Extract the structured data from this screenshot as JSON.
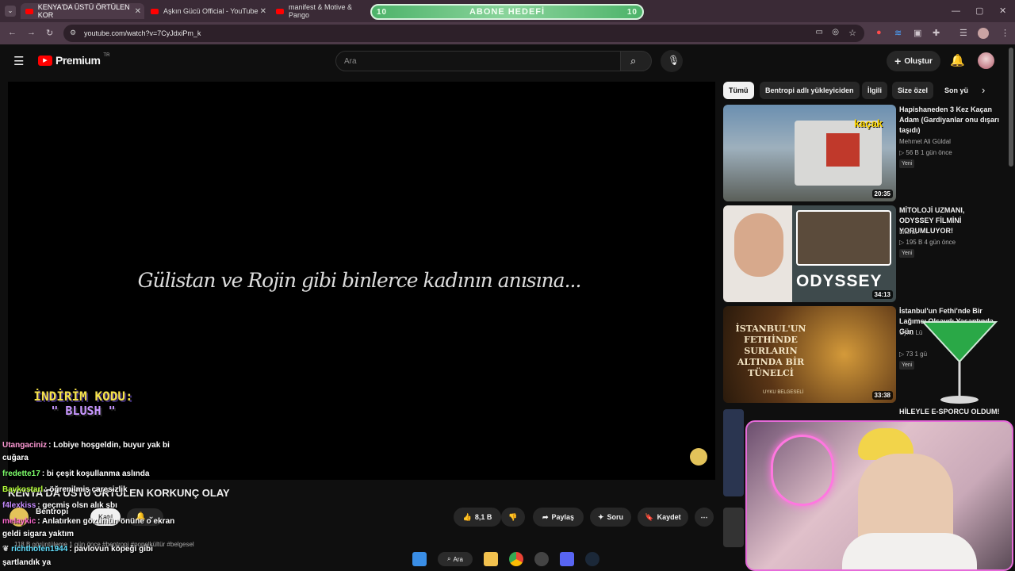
{
  "browser": {
    "tabs": [
      {
        "label": "KENYA'DA ÜSTÜ ÖRTÜLEN KOR"
      },
      {
        "label": "Aşkın Gücü Official - YouTube"
      },
      {
        "label": "manifest & Motive & Pango"
      }
    ],
    "url": "youtube.com/watch?v=7CyJdxiPm_k",
    "abone_label": "ABONE HEDEFİ",
    "abone_left": "10",
    "abone_right": "10"
  },
  "youtube": {
    "logo": "Premium",
    "region": "TR",
    "search_placeholder": "Ara",
    "create_label": "Oluştur"
  },
  "player": {
    "caption": "Gülistan ve Rojin gibi binlerce kadının anısına...",
    "discount_line1": "İNDİRİM KODU:",
    "discount_line2": "\" BLUSH \""
  },
  "chips": [
    "Tümü",
    "Bentropi adlı yükleyiciden",
    "İlgili",
    "Size özel",
    "Son yü"
  ],
  "recommendations": [
    {
      "title": "Hapishaneden 3 Kez Kaçan Adam (Gardiyanlar onu dışarı taşıdı)",
      "channel": "Mehmet Ali Güldal",
      "meta": "▷ 56 B  1 gün önce",
      "badge": "Yeni",
      "duration": "20:35",
      "thumb_text": "kaçak"
    },
    {
      "title": "MİTOLOJİ UZMANI, ODYSSEY FİLMİNİ YORUMLUYOR!",
      "channel": "Literat",
      "meta": "▷ 195 B  4 gün önce",
      "badge": "Yeni",
      "duration": "34:13",
      "thumb_text": "ODYSSEY"
    },
    {
      "title": "İstanbul'un Fethi'nde Bir Lağımcı Olsaydı Yaşantında Gün",
      "channel": "Uyku Lü",
      "meta": "▷ 73   1 gü",
      "badge": "Yeni",
      "duration": "33:38",
      "thumb_text": "İSTANBUL'UN FETHİNDE SURLARIN ALTINDA BİR TÜNELCİ",
      "thumb_sub": "UYKU BELGESELİ"
    },
    {
      "title": "HİLEYLE E-SPORCU OLDUM!",
      "channel": "",
      "meta": "",
      "badge": "",
      "duration": "",
      "thumb_text": ""
    }
  ],
  "chat": [
    {
      "user": "Utangaciniz",
      "color": "#ff9ad6",
      "msg": ": Lobiye hoşgeldin, buyur yak bi"
    },
    {
      "user": "",
      "color": "#ffffff",
      "msg": "cuğara"
    },
    {
      "user": "fredette17",
      "color": "#7dff6a",
      "msg": ": bi çeşit koşullanma aslında"
    },
    {
      "user": "Baykostarl",
      "color": "#b6ff3a",
      "msg": ": öğrenilmiş çaresizlik"
    },
    {
      "user": "f4lexkiss",
      "color": "#c68bff",
      "msg": ": geçmiş olsn alık şbı"
    },
    {
      "user": "melaykic",
      "color": "#ff6ad0",
      "msg": ": Anlatırken gözümün önüne o ekran"
    },
    {
      "user": "",
      "color": "#ffffff",
      "msg": "geldi sigara yaktım"
    },
    {
      "user": "richthofen1944",
      "color": "#63e0ff",
      "msg": ": pavlovun köpeği gibi"
    },
    {
      "user": "",
      "color": "#ffffff",
      "msg": "şartlandık ya"
    }
  ],
  "video": {
    "title": "KENYA'DA ÜSTÜ ÖRTÜLEN KORKUNÇ OLAY",
    "channel": "Bentropi",
    "join_label": "Katıl",
    "stats": "118 B görüntüleme  1 gün önce  #bentropi #popelkültür #belgesel",
    "likes": "8,1 B",
    "share_label": "Paylaş",
    "ask_label": "Soru",
    "save_label": "Kaydet"
  },
  "taskbar": {
    "search_label": "Ara"
  }
}
